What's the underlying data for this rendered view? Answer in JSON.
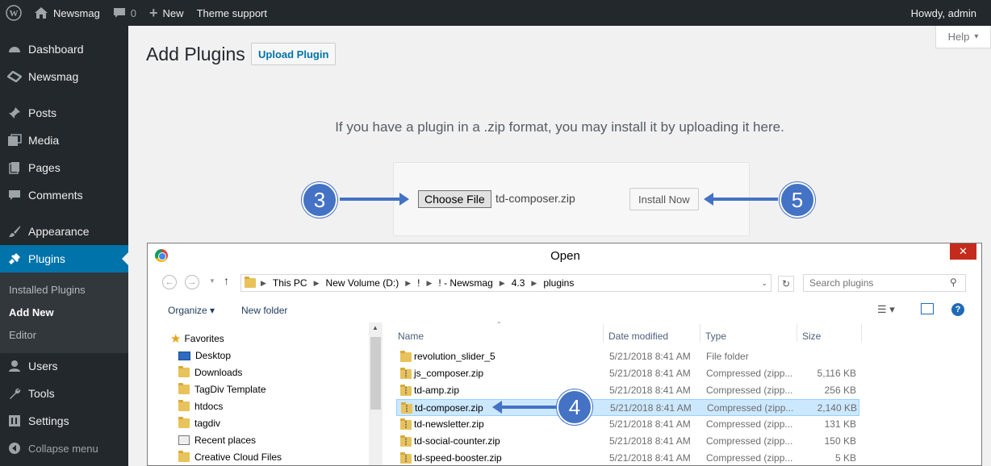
{
  "adminbar": {
    "site_name": "Newsmag",
    "comments_count": "0",
    "new_label": "New",
    "theme_support": "Theme support",
    "howdy": "Howdy, admin"
  },
  "sidebar": {
    "items": [
      {
        "label": "Dashboard",
        "icon": "dashboard-icon"
      },
      {
        "label": "Newsmag",
        "icon": "newsmag-icon"
      },
      {
        "label": "Posts",
        "icon": "pin-icon"
      },
      {
        "label": "Media",
        "icon": "media-icon"
      },
      {
        "label": "Pages",
        "icon": "pages-icon"
      },
      {
        "label": "Comments",
        "icon": "comments-icon"
      },
      {
        "label": "Appearance",
        "icon": "brush-icon"
      },
      {
        "label": "Plugins",
        "icon": "plug-icon"
      },
      {
        "label": "Users",
        "icon": "users-icon"
      },
      {
        "label": "Tools",
        "icon": "wrench-icon"
      },
      {
        "label": "Settings",
        "icon": "settings-icon"
      }
    ],
    "submenu": [
      "Installed Plugins",
      "Add New",
      "Editor"
    ],
    "collapse": "Collapse menu"
  },
  "main": {
    "title": "Add Plugins",
    "upload_button": "Upload Plugin",
    "help": "Help",
    "description": "If you have a plugin in a .zip format, you may install it by uploading it here.",
    "choose_file": "Choose File",
    "file_name": "td-composer.zip",
    "install_now": "Install Now"
  },
  "steps": {
    "s3": "3",
    "s4": "4",
    "s5": "5"
  },
  "dialog": {
    "title": "Open",
    "breadcrumb": [
      "This PC",
      "New Volume (D:)",
      "!",
      "! - Newsmag",
      "4.3",
      "plugins"
    ],
    "search_placeholder": "Search plugins",
    "organize": "Organize",
    "new_folder": "New folder",
    "nav": [
      {
        "label": "Favorites"
      },
      {
        "label": "Desktop"
      },
      {
        "label": "Downloads"
      },
      {
        "label": "TagDiv Template"
      },
      {
        "label": "htdocs"
      },
      {
        "label": "tagdiv"
      },
      {
        "label": "Recent places"
      },
      {
        "label": "Creative Cloud Files"
      }
    ],
    "columns": [
      "Name",
      "Date modified",
      "Type",
      "Size"
    ],
    "files": [
      {
        "name": "revolution_slider_5",
        "date": "5/21/2018 8:41 AM",
        "type": "File folder",
        "size": ""
      },
      {
        "name": "js_composer.zip",
        "date": "5/21/2018 8:41 AM",
        "type": "Compressed (zipp...",
        "size": "5,116 KB"
      },
      {
        "name": "td-amp.zip",
        "date": "5/21/2018 8:41 AM",
        "type": "Compressed (zipp...",
        "size": "256 KB"
      },
      {
        "name": "td-composer.zip",
        "date": "5/21/2018 8:41 AM",
        "type": "Compressed (zipp...",
        "size": "2,140 KB"
      },
      {
        "name": "td-newsletter.zip",
        "date": "5/21/2018 8:41 AM",
        "type": "Compressed (zipp...",
        "size": "131 KB"
      },
      {
        "name": "td-social-counter.zip",
        "date": "5/21/2018 8:41 AM",
        "type": "Compressed (zipp...",
        "size": "150 KB"
      },
      {
        "name": "td-speed-booster.zip",
        "date": "5/21/2018 8:41 AM",
        "type": "Compressed (zipp...",
        "size": "5 KB"
      }
    ]
  },
  "colors": {
    "accent": "#0073aa",
    "step": "#4472c4",
    "adminbar": "#23282d"
  }
}
